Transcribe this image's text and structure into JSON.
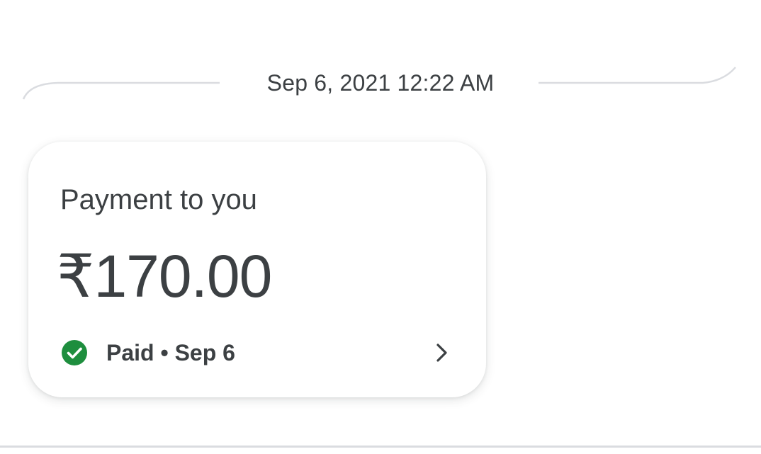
{
  "thread": {
    "timestamp": "Sep 6, 2021 12:22 AM"
  },
  "payment_card": {
    "title": "Payment to you",
    "amount": "₹170.00",
    "status_text": "Paid • Sep 6",
    "status_icon": "check-circle-icon",
    "chevron_icon": "chevron-right-icon"
  },
  "colors": {
    "text": "#3c4043",
    "success": "#1e8e3e",
    "divider": "#dadce0"
  }
}
